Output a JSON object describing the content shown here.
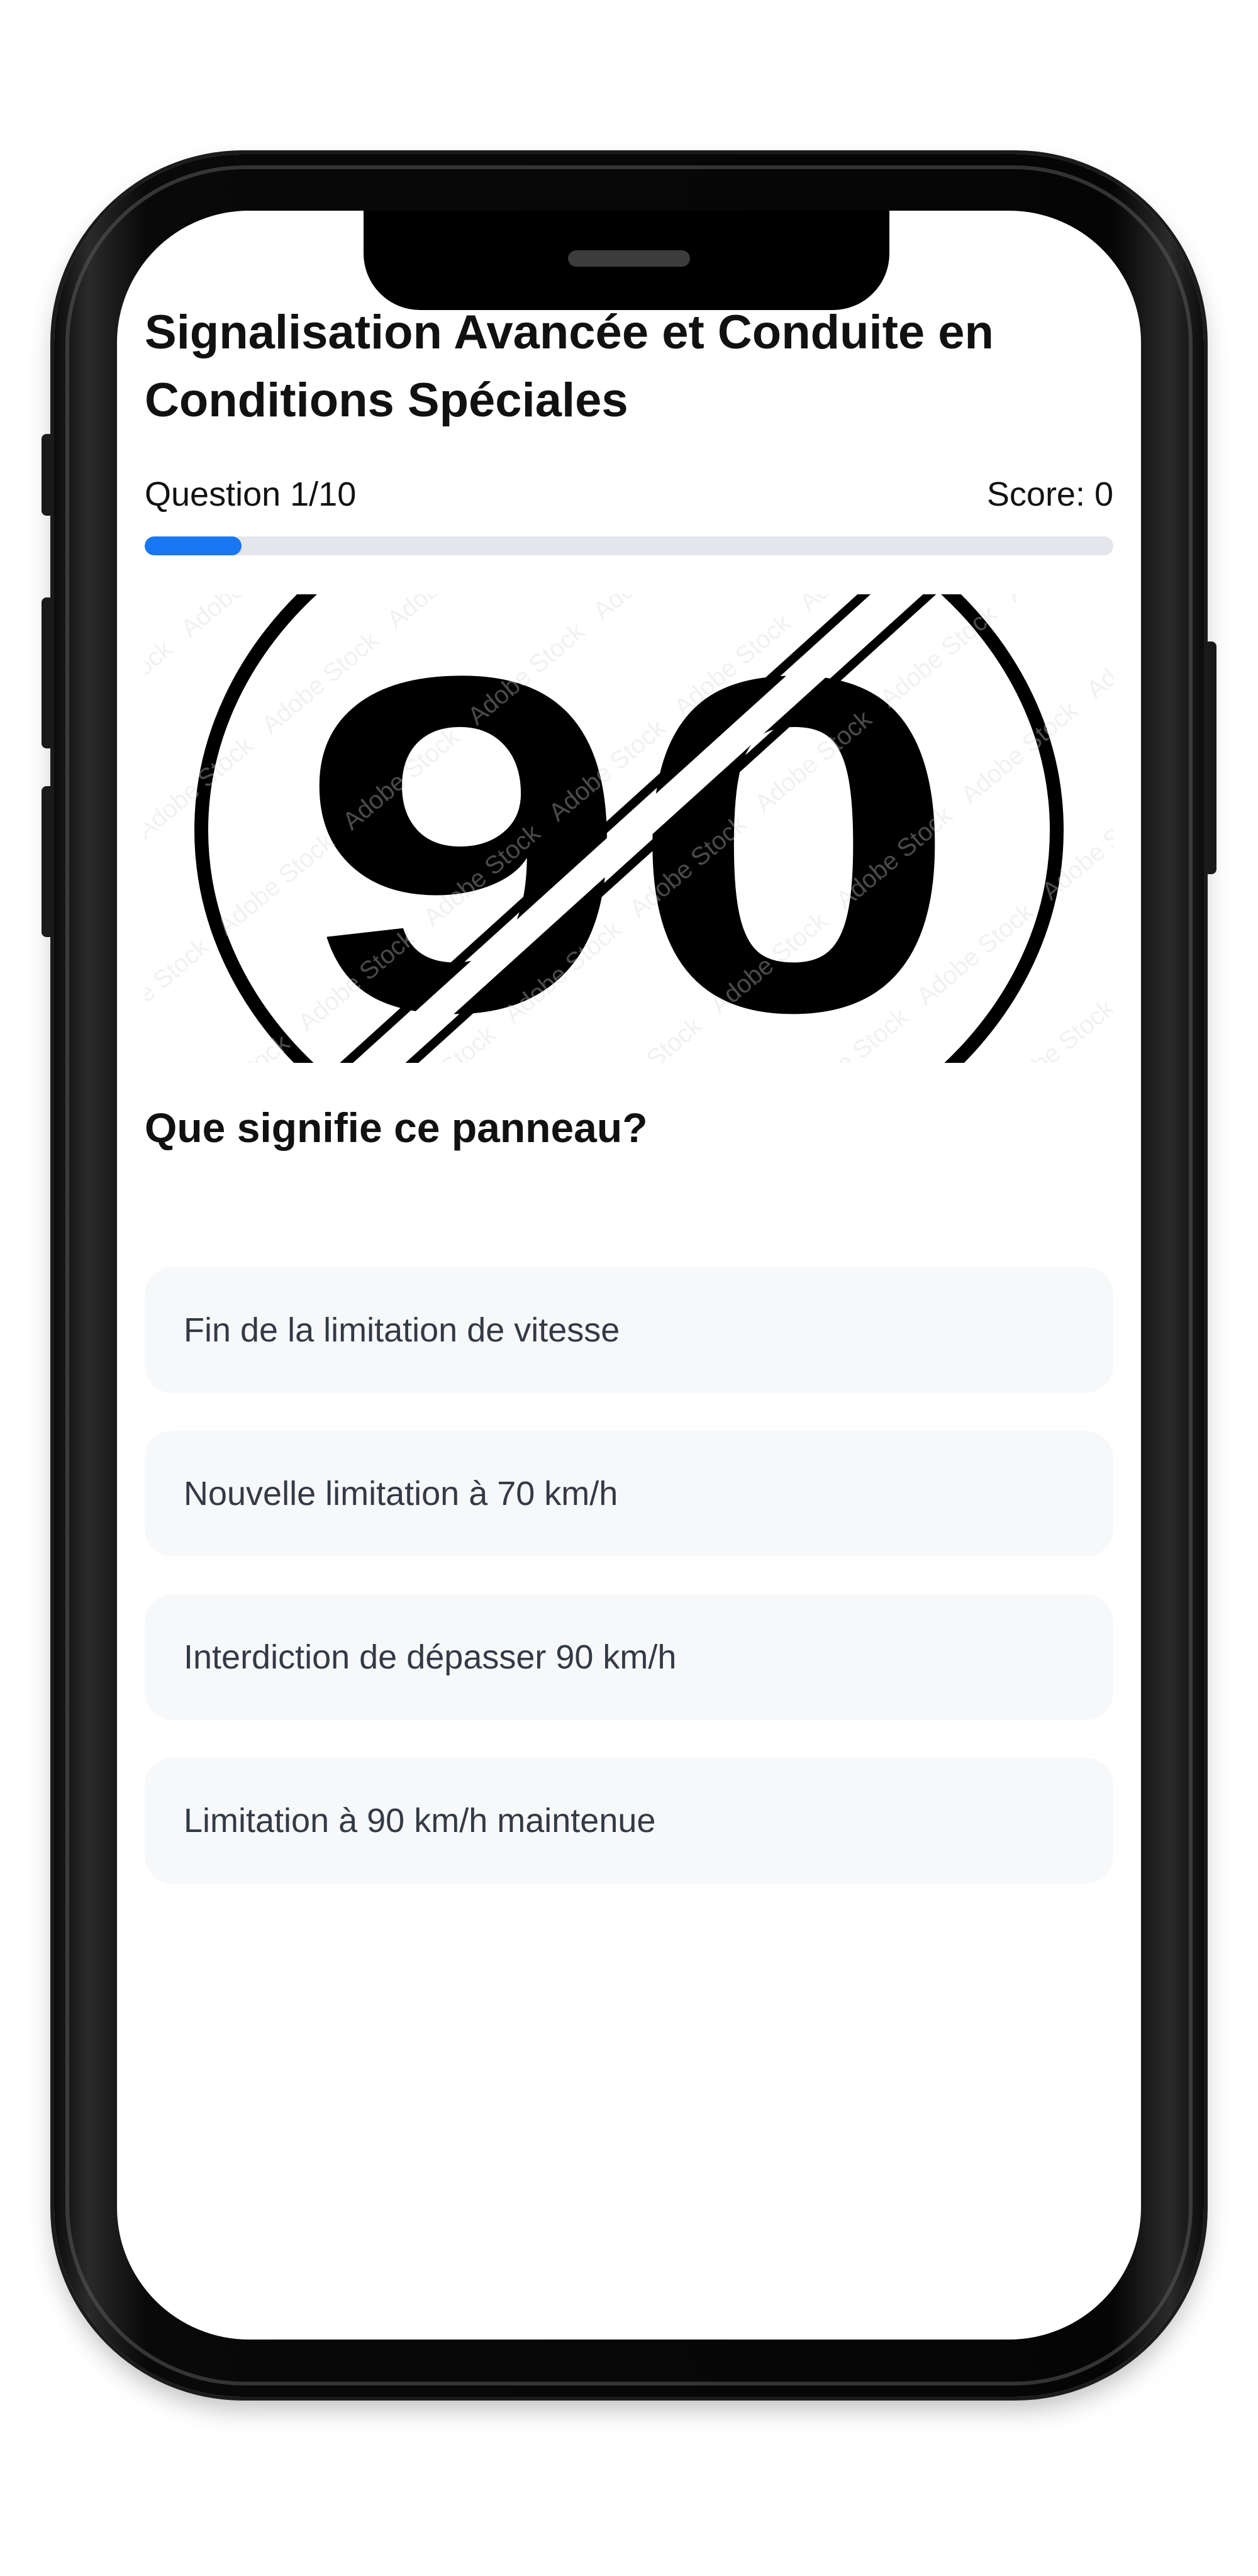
{
  "quiz": {
    "title": "Signalisation Avancée et Conduite en Conditions Spéciales",
    "question_counter": "Question 1/10",
    "score": "Score: 0",
    "progress_fraction": 0.1,
    "question": "Que signifie ce panneau?",
    "sign": {
      "number": "90",
      "watermark": "Adobe Stock"
    },
    "options": [
      {
        "label": "Fin de la limitation de vitesse"
      },
      {
        "label": "Nouvelle limitation à 70 km/h"
      },
      {
        "label": "Interdiction de dépasser 90 km/h"
      },
      {
        "label": "Limitation à 90 km/h maintenue"
      }
    ]
  },
  "colors": {
    "accent": "#1877f2",
    "track": "#e4e6eb",
    "option_bg": "#f7f8fa",
    "option_text": "#333a46",
    "title_text": "#111111"
  }
}
